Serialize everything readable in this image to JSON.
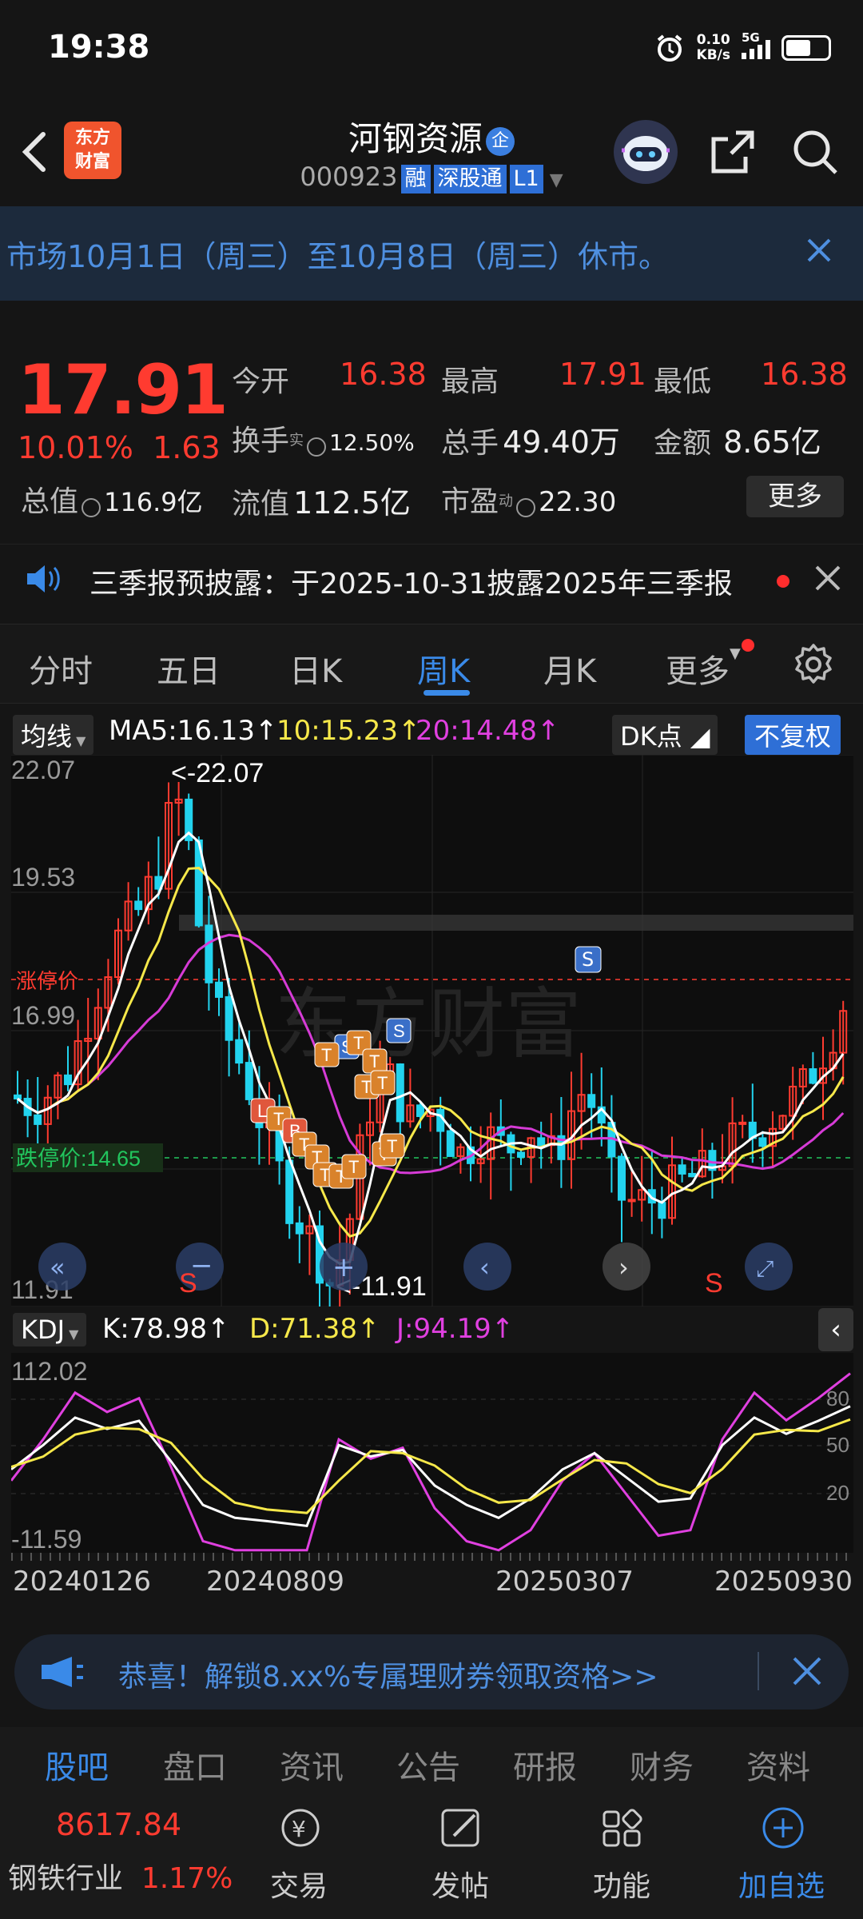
{
  "status": {
    "time": "19:38",
    "net_speed": "0.10",
    "net_unit": "KB/s",
    "net_type": "5G",
    "battery_pct": 50
  },
  "header": {
    "logo_line1": "东方",
    "logo_line2": "财富",
    "stock_name": "河钢资源",
    "qi_badge": "企",
    "code": "000923",
    "tag_rong": "融",
    "tag_sgt": "深股通",
    "tag_l1": "L1"
  },
  "notice": {
    "text": "市场10月1日（周三）至10月8日（周三）休市。"
  },
  "quote": {
    "price": "17.91",
    "change_pct": "10.01%",
    "change_amt": "1.63",
    "open_label": "今开",
    "open": "16.38",
    "high_label": "最高",
    "high": "17.91",
    "low_label": "最低",
    "low": "16.38",
    "turnover_label": "换手",
    "turnover_sup": "实",
    "turnover": "12.50%",
    "volume_label": "总手",
    "volume": "49.40万",
    "amount_label": "金额",
    "amount": "8.65亿",
    "mktcap_label": "总值",
    "mktcap": "116.9亿",
    "float_label": "流值",
    "float": "112.5亿",
    "pe_label": "市盈",
    "pe_sup": "动",
    "pe": "22.30",
    "more": "更多"
  },
  "report": {
    "text": "三季报预披露：于2025-10-31披露2025年三季报"
  },
  "tabs": [
    "分时",
    "五日",
    "日K",
    "周K",
    "月K",
    "更多"
  ],
  "ma": {
    "dropdown": "均线",
    "ma5": "MA5:16.13↑",
    "ma10": "10:15.23↑",
    "ma20": "20:14.48↑",
    "dk": "DK点",
    "fq": "不复权"
  },
  "kdj": {
    "dropdown": "KDJ",
    "k": "K:78.98↑",
    "d": "D:71.38↑",
    "j": "J:94.19↑",
    "top": "112.02",
    "bottom": "-11.59",
    "l80": "80",
    "l50": "50",
    "l20": "20"
  },
  "chart_labels": {
    "y_top": "22.07",
    "y_mid": "19.53",
    "y_16": "16.99",
    "y_low": "11.91",
    "max": "<-22.07",
    "min": "<-11.91",
    "limit_up": "涨停价",
    "limit_down": "跌停价:14.65",
    "watermark": "东方财富"
  },
  "chart_data": {
    "type": "candlestick",
    "y_range": [
      11.91,
      22.07
    ],
    "highs_lows": {
      "max": 22.07,
      "min": 11.91
    },
    "ma": {
      "MA5": 16.13,
      "MA10": 15.23,
      "MA20": 14.48
    },
    "x_ticks": [
      "20240126",
      "20240809",
      "20250307",
      "20250930"
    ]
  },
  "dates": [
    "20240126",
    "20240809",
    "20250307",
    "20250930"
  ],
  "promo": {
    "text": "恭喜！解锁8.xx%专属理财券领取资格>>"
  },
  "bottom_tabs": [
    "股吧",
    "盘口",
    "资讯",
    "公告",
    "研报",
    "财务",
    "资料"
  ],
  "nav": {
    "industry_price": "8617.84",
    "industry_name": "钢铁行业",
    "industry_chg": "1.17%",
    "trade": "交易",
    "post": "发帖",
    "func": "功能",
    "add": "加自选"
  },
  "colors": {
    "up": "#ff3b30",
    "down": "#22d3ee",
    "accent": "#3a8ae8"
  }
}
